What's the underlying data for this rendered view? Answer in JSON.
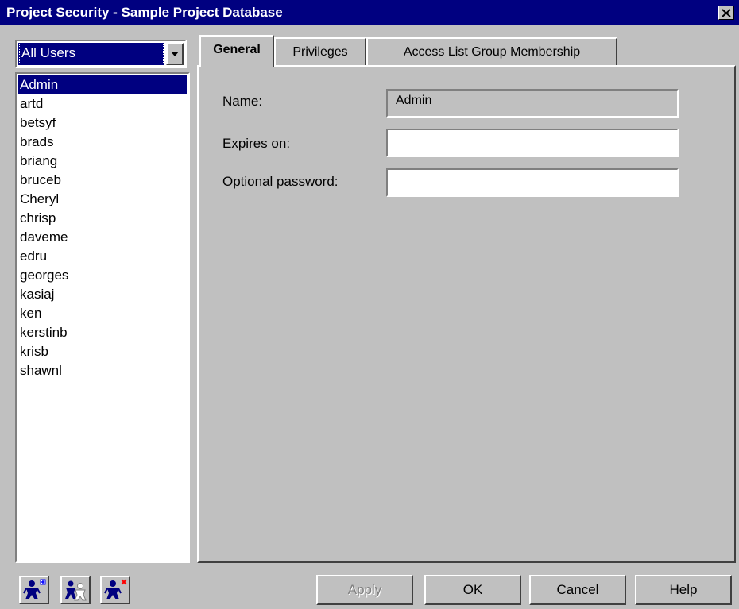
{
  "window": {
    "title": "Project Security - Sample Project Database",
    "close_glyph": "✕"
  },
  "user_filter": {
    "selected": "All Users"
  },
  "users": [
    {
      "label": "Admin",
      "selected": true
    },
    {
      "label": "artd"
    },
    {
      "label": "betsyf"
    },
    {
      "label": "brads"
    },
    {
      "label": "briang"
    },
    {
      "label": "bruceb"
    },
    {
      "label": "Cheryl"
    },
    {
      "label": "chrisp"
    },
    {
      "label": "daveme"
    },
    {
      "label": "edru"
    },
    {
      "label": "georges"
    },
    {
      "label": "kasiaj"
    },
    {
      "label": "ken"
    },
    {
      "label": "kerstinb"
    },
    {
      "label": "krisb"
    },
    {
      "label": "shawnl"
    }
  ],
  "tabs": [
    {
      "label": "General",
      "active": true
    },
    {
      "label": "Privileges"
    },
    {
      "label": "Access List Group Membership"
    }
  ],
  "general": {
    "name_label": "Name:",
    "name_value": "Admin",
    "expires_label": "Expires on:",
    "expires_value": "",
    "password_label": "Optional password:",
    "password_value": ""
  },
  "toolbar_icons": [
    {
      "name": "add-user-icon"
    },
    {
      "name": "copy-user-icon"
    },
    {
      "name": "delete-user-icon"
    }
  ],
  "buttons": {
    "apply": "Apply",
    "ok": "OK",
    "cancel": "Cancel",
    "help": "Help"
  },
  "colors": {
    "title_bar": "#000080",
    "selection": "#000080",
    "face": "#c0c0c0",
    "add_badge": "#0000ff",
    "delete_badge": "#ff0000"
  }
}
